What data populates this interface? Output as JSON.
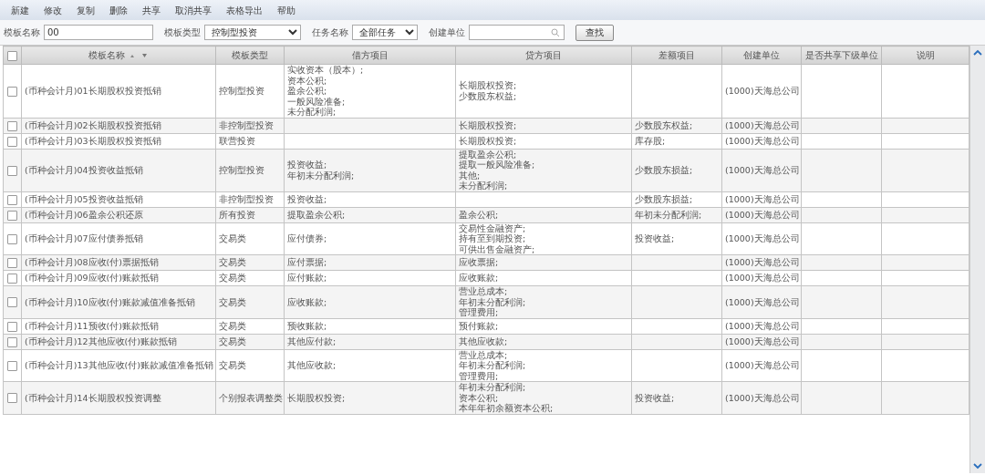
{
  "toolbar": [
    "新建",
    "修改",
    "复制",
    "删除",
    "共享",
    "取消共享",
    "表格导出",
    "帮助"
  ],
  "filters": [
    {
      "kind": "text",
      "label": "模板名称",
      "value": "00"
    },
    {
      "kind": "select",
      "label": "模板类型",
      "value": "控制型投资"
    },
    {
      "kind": "select",
      "label": "任务名称",
      "value": "全部任务"
    },
    {
      "kind": "search",
      "label": "创建单位"
    }
  ],
  "search_button": "查找",
  "table": {
    "select_all": {
      "checked": false
    },
    "columns": [
      "模板名称",
      "模板类型",
      "借方项目",
      "贷方项目",
      "差额项目",
      "创建单位",
      "是否共享下级单位",
      "说明"
    ],
    "rows": [
      {
        "checked": false,
        "name": "(币种会计月)01长期股权投资抵销",
        "type": "控制型投资",
        "debit": [
          "实收资本（股本）;",
          "资本公积;",
          "盈余公积;",
          "一般风险准备;",
          "未分配利润;"
        ],
        "credit": [
          "长期股权投资;",
          "少数股东权益;"
        ],
        "difference": [],
        "unit": "(1000)天海总公司"
      },
      {
        "checked": false,
        "name": "(币种会计月)02长期股权投资抵销",
        "type": "非控制型投资",
        "debit": [],
        "credit": [
          "长期股权投资;"
        ],
        "difference": [
          "少数股东权益;"
        ],
        "unit": "(1000)天海总公司"
      },
      {
        "checked": false,
        "name": "(币种会计月)03长期股权投资抵销",
        "type": "联营投资",
        "debit": [],
        "credit": [
          "长期股权投资;"
        ],
        "difference": [
          "库存股;"
        ],
        "unit": "(1000)天海总公司"
      },
      {
        "checked": false,
        "name": "(币种会计月)04投资收益抵销",
        "type": "控制型投资",
        "debit": [
          "投资收益;",
          "年初未分配利润;"
        ],
        "credit": [
          "提取盈余公积;",
          "提取一般风险准备;",
          "其他;",
          "未分配利润;"
        ],
        "difference": [
          "少数股东损益;"
        ],
        "unit": "(1000)天海总公司"
      },
      {
        "checked": false,
        "name": "(币种会计月)05投资收益抵销",
        "type": "非控制型投资",
        "debit": [
          "投资收益;"
        ],
        "credit": [],
        "difference": [
          "少数股东损益;"
        ],
        "unit": "(1000)天海总公司"
      },
      {
        "checked": false,
        "name": "(币种会计月)06盈余公积还原",
        "type": "所有投资",
        "debit": [
          "提取盈余公积;"
        ],
        "credit": [
          "盈余公积;"
        ],
        "difference": [
          "年初未分配利润;"
        ],
        "unit": "(1000)天海总公司"
      },
      {
        "checked": false,
        "name": "(币种会计月)07应付债券抵销",
        "type": "交易类",
        "debit": [
          "应付债券;"
        ],
        "credit": [
          "交易性金融资产;",
          "持有至到期投资;",
          "可供出售金融资产;"
        ],
        "difference": [
          "投资收益;"
        ],
        "unit": "(1000)天海总公司"
      },
      {
        "checked": false,
        "name": "(币种会计月)08应收(付)票据抵销",
        "type": "交易类",
        "debit": [
          "应付票据;"
        ],
        "credit": [
          "应收票据;"
        ],
        "difference": [],
        "unit": "(1000)天海总公司"
      },
      {
        "checked": false,
        "name": "(币种会计月)09应收(付)账款抵销",
        "type": "交易类",
        "debit": [
          "应付账款;"
        ],
        "credit": [
          "应收账款;"
        ],
        "difference": [],
        "unit": "(1000)天海总公司"
      },
      {
        "checked": false,
        "name": "(币种会计月)10应收(付)账款减值准备抵销",
        "type": "交易类",
        "debit": [
          "应收账款;"
        ],
        "credit": [
          "营业总成本;",
          "年初未分配利润;",
          "管理费用;"
        ],
        "difference": [],
        "unit": "(1000)天海总公司"
      },
      {
        "checked": false,
        "name": "(币种会计月)11预收(付)账款抵销",
        "type": "交易类",
        "debit": [
          "预收账款;"
        ],
        "credit": [
          "预付账款;"
        ],
        "difference": [],
        "unit": "(1000)天海总公司"
      },
      {
        "checked": false,
        "name": "(币种会计月)12其他应收(付)账款抵销",
        "type": "交易类",
        "debit": [
          "其他应付款;"
        ],
        "credit": [
          "其他应收款;"
        ],
        "difference": [],
        "unit": "(1000)天海总公司"
      },
      {
        "checked": false,
        "name": "(币种会计月)13其他应收(付)账款减值准备抵销",
        "type": "交易类",
        "debit": [
          "其他应收款;"
        ],
        "credit": [
          "营业总成本;",
          "年初未分配利润;",
          "管理费用;"
        ],
        "difference": [],
        "unit": "(1000)天海总公司"
      },
      {
        "checked": false,
        "name": "(币种会计月)14长期股权投资调整",
        "type": "个别报表调整类",
        "debit": [
          "长期股权投资;"
        ],
        "credit": [
          "年初未分配利润;",
          "资本公积;",
          "本年年初余额资本公积;"
        ],
        "difference": [
          "投资收益;"
        ],
        "unit": "(1000)天海总公司"
      }
    ]
  }
}
